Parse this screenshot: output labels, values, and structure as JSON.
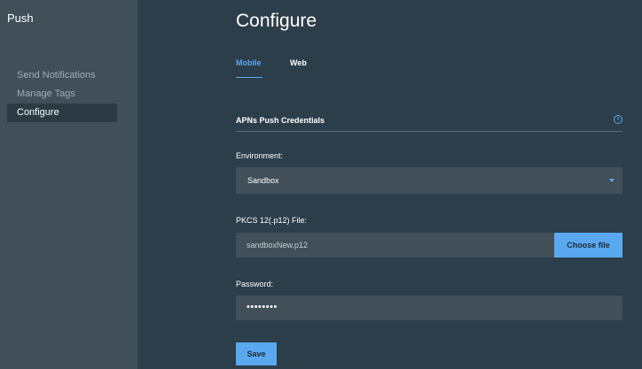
{
  "app": {
    "title": "Push"
  },
  "sidebar": {
    "items": [
      {
        "label": "Send Notifications"
      },
      {
        "label": "Manage Tags"
      },
      {
        "label": "Configure"
      }
    ]
  },
  "main": {
    "title": "Configure",
    "tabs": [
      {
        "label": "Mobile"
      },
      {
        "label": "Web"
      }
    ],
    "section": {
      "title": "APNs Push Credentials",
      "info_icon": "i"
    },
    "environment": {
      "label": "Environment:",
      "value": "Sandbox"
    },
    "file": {
      "label": "PKCS 12(.p12) File:",
      "value": "sandboxNew.p12",
      "button": "Choose file"
    },
    "password": {
      "label": "Password:",
      "value": "••••••••"
    },
    "save_label": "Save"
  },
  "colors": {
    "accent": "#5aa9f0",
    "background": "#2c3e4a",
    "sidebar": "#414f59"
  }
}
